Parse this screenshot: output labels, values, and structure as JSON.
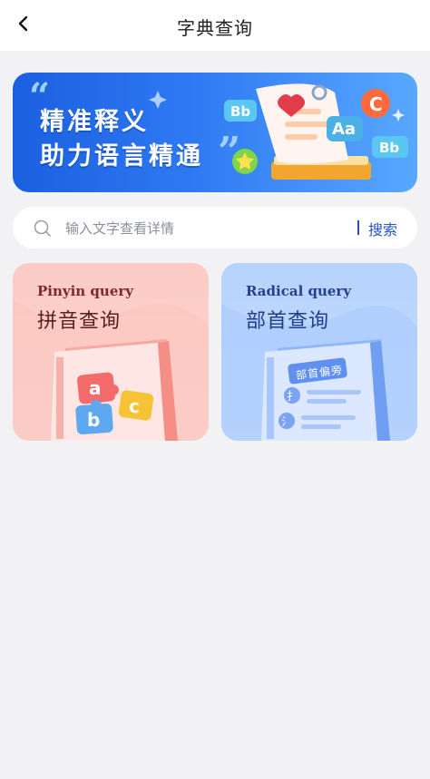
{
  "header": {
    "title": "字典查询",
    "back_icon": "chevron-left-icon"
  },
  "banner": {
    "line1": "精准释义",
    "line2": "助力语言精通",
    "badges": [
      "Bb",
      "Aa",
      "C",
      "Bb"
    ],
    "colors": {
      "start": "#1a5fe0",
      "end": "#58a8ff"
    }
  },
  "search": {
    "placeholder": "输入文字查看详情",
    "button_label": "搜索",
    "icon": "search-icon"
  },
  "cards": [
    {
      "title_en": "Pinyin query",
      "title_zh": "拼音查询",
      "letters": [
        "a",
        "b",
        "c"
      ]
    },
    {
      "title_en": "Radical query",
      "title_zh": "部首查询",
      "tag_label": "部首偏旁",
      "icon_glyphs": [
        "扌",
        "氵"
      ]
    }
  ]
}
